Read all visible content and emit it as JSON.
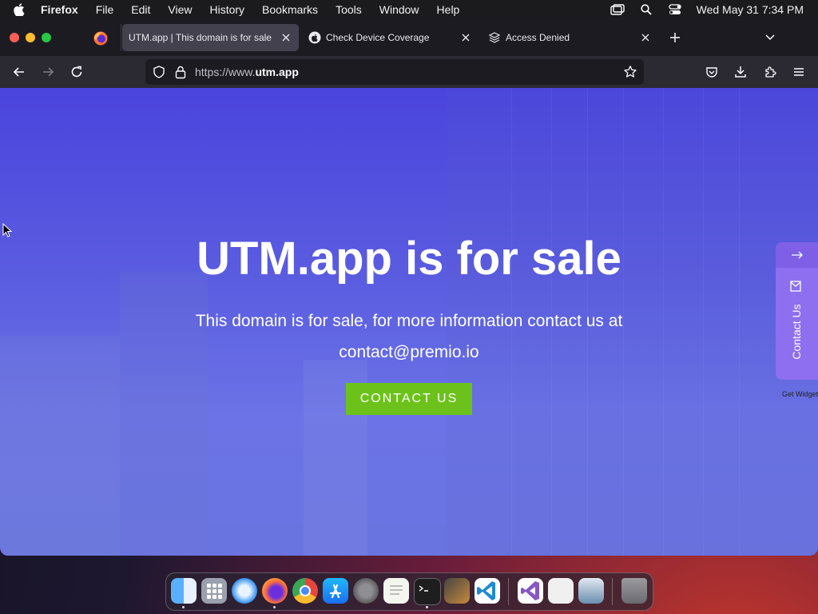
{
  "menubar": {
    "app_name": "Firefox",
    "menus": [
      "File",
      "Edit",
      "View",
      "History",
      "Bookmarks",
      "Tools",
      "Window",
      "Help"
    ],
    "clock": "Wed May 31  7:34 PM"
  },
  "tabs": [
    {
      "label": "UTM.app | This domain is for sale",
      "active": true,
      "favicon": "none"
    },
    {
      "label": "Check Device Coverage",
      "active": false,
      "favicon": "apple-icon"
    },
    {
      "label": "Access Denied",
      "active": false,
      "favicon": "stack-icon"
    }
  ],
  "urlbar": {
    "url_prefix": "https://www.",
    "url_domain": "utm.app"
  },
  "page": {
    "title": "UTM.app is for sale",
    "text": "This domain is for sale, for more information contact us at contact@premio.io",
    "button_label": "CONTACT US",
    "widget_label": "Contact Us",
    "widget_footer": "Get Widget"
  },
  "colors": {
    "page_top": "#4a44dd",
    "page_bottom": "#6a74e0",
    "button": "#6cc21a",
    "widget": "#8d6ff0"
  },
  "dock": {
    "apps": [
      "Finder",
      "Launchpad",
      "Safari",
      "Firefox",
      "Chrome",
      "App Store",
      "System Settings",
      "TextEdit",
      "Terminal",
      "Instruments",
      "Visual Studio Code",
      "Visual Studio",
      "Preview",
      "Image Capture",
      "Trash"
    ]
  }
}
